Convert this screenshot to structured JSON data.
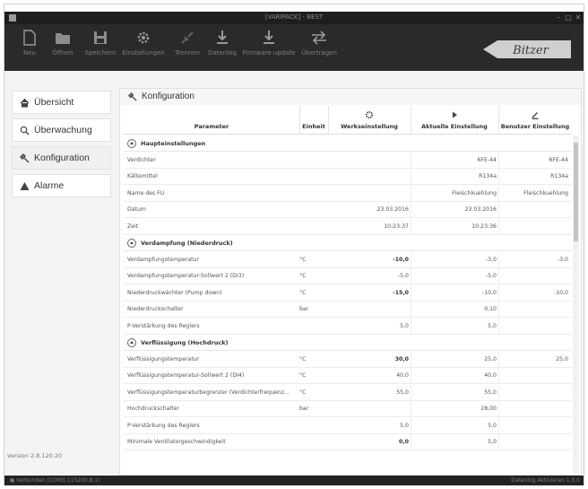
{
  "window": {
    "title": "[VARIPACK] - BEST",
    "minimize": "–",
    "maximize": "□",
    "close": "✕"
  },
  "toolbar": [
    {
      "label": "Neu",
      "icon": "new-file-icon"
    },
    {
      "label": "Öffnen",
      "icon": "folder-icon"
    },
    {
      "label": "Speichern",
      "icon": "save-icon"
    },
    {
      "label": "Einstellungen",
      "icon": "gear-icon"
    },
    {
      "label": "Trennen",
      "icon": "disconnect-icon"
    },
    {
      "label": "Datenlog",
      "icon": "download-icon"
    },
    {
      "label": "Firmware update",
      "icon": "firmware-update-icon"
    },
    {
      "label": "Übertragen",
      "icon": "transfer-icon"
    }
  ],
  "logo": "Bitzer",
  "sidebar": {
    "items": [
      {
        "label": "Übersicht",
        "icon": "home-icon"
      },
      {
        "label": "Überwachung",
        "icon": "search-icon"
      },
      {
        "label": "Konfiguration",
        "icon": "wrench-icon"
      },
      {
        "label": "Alarme",
        "icon": "warning-icon"
      }
    ],
    "version": "Version 2.8.120.20"
  },
  "panel": {
    "title": "Konfiguration"
  },
  "columns": {
    "parameter": "Parameter",
    "unit": "Einheit",
    "factory": "Werkseinstellung",
    "current": "Aktuelle Einstellung",
    "user": "Benutzer Einstellung"
  },
  "sections": [
    {
      "title": "Haupteinstellungen",
      "rows": [
        {
          "p": "Verdichter",
          "u": "",
          "w": "",
          "a": "6FE-44",
          "b": "6FE-44"
        },
        {
          "p": "Kältemittel",
          "u": "",
          "w": "",
          "a": "R134a",
          "b": "R134a"
        },
        {
          "p": "Name des FU",
          "u": "",
          "w": "",
          "a": "Fleischkuehlung",
          "b": "Fleischkuehlung"
        },
        {
          "p": "Datum",
          "u": "",
          "w": "23.03.2016",
          "a": "23.03.2016",
          "b": ""
        },
        {
          "p": "Zeit",
          "u": "",
          "w": "10:23:37",
          "a": "10:23:36",
          "b": ""
        }
      ]
    },
    {
      "title": "Verdampfung (Niederdruck)",
      "rows": [
        {
          "p": "Verdampfungstemperatur",
          "u": "°C",
          "w": "-10,0",
          "wb": true,
          "a": "-3,0",
          "b": "-3,0"
        },
        {
          "p": "Verdampfungstemperatur-Sollwert 2 (DI3)",
          "u": "°C",
          "w": "-5,0",
          "a": "-5,0",
          "b": ""
        },
        {
          "p": "Niederdruckwächter (Pump down)",
          "u": "°C",
          "w": "-15,0",
          "wb": true,
          "a": "-10,0",
          "b": "-10,0"
        },
        {
          "p": "Niederdruckschalter",
          "u": "bar",
          "w": "",
          "a": "0,10",
          "b": ""
        },
        {
          "p": "P-Verstärkung des Reglers",
          "u": "",
          "w": "5,0",
          "a": "5,0",
          "b": ""
        }
      ]
    },
    {
      "title": "Verflüssigung (Hochdruck)",
      "rows": [
        {
          "p": "Verflüssigungstemperatur",
          "u": "°C",
          "w": "30,0",
          "wb": true,
          "a": "25,0",
          "b": "25,0"
        },
        {
          "p": "Verflüssigungstemperatur-Sollwert 2 (DI4)",
          "u": "°C",
          "w": "40,0",
          "a": "40,0",
          "b": ""
        },
        {
          "p": "Verflüssigungstemperaturbegrenzer (Verdichterfrequenz...",
          "u": "°C",
          "w": "55,0",
          "a": "55,0",
          "b": ""
        },
        {
          "p": "Hochdruckschalter",
          "u": "bar",
          "w": "",
          "a": "28,00",
          "b": ""
        },
        {
          "p": "P-Verstärkung des Reglers",
          "u": "",
          "w": "5,0",
          "a": "5,0",
          "b": ""
        },
        {
          "p": "Minimale Ventilatorgeschwindigkeit",
          "u": "",
          "w": "0,0",
          "wb": true,
          "a": "5,0",
          "b": ""
        }
      ]
    }
  ],
  "status": {
    "left": "● Verbunden (COM3,115200,8,1)",
    "right": "Datenlog Aktivieren   1.0.0"
  }
}
